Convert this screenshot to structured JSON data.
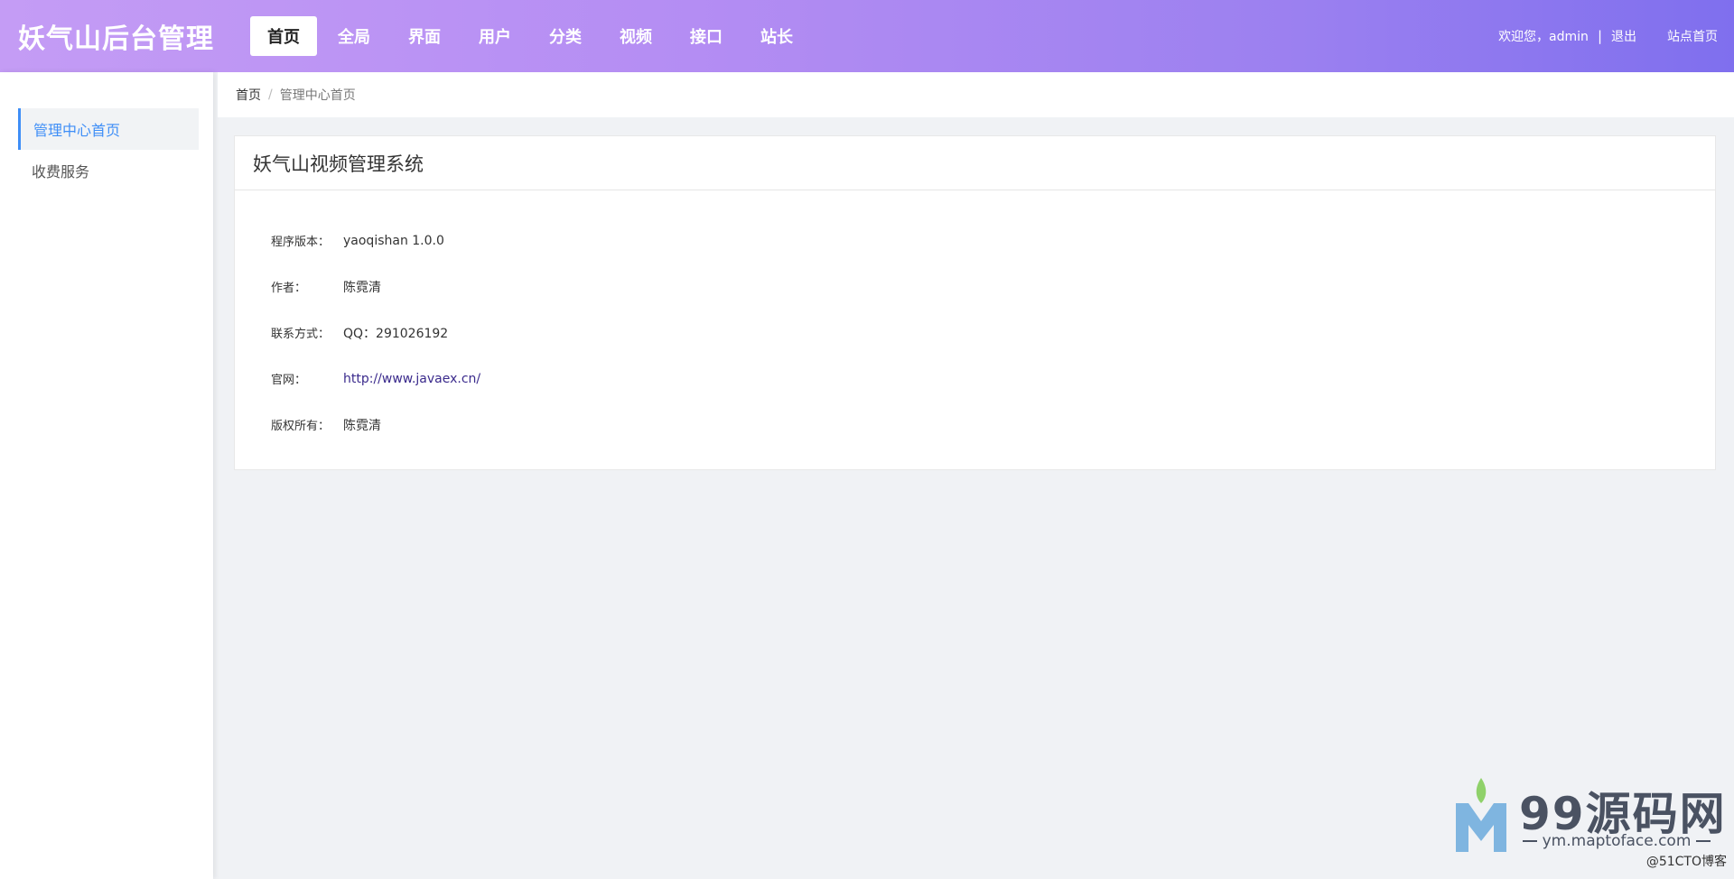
{
  "header": {
    "brand": "妖气山后台管理",
    "nav": [
      {
        "label": "首页",
        "active": true
      },
      {
        "label": "全局",
        "active": false
      },
      {
        "label": "界面",
        "active": false
      },
      {
        "label": "用户",
        "active": false
      },
      {
        "label": "分类",
        "active": false
      },
      {
        "label": "视频",
        "active": false
      },
      {
        "label": "接口",
        "active": false
      },
      {
        "label": "站长",
        "active": false
      }
    ],
    "welcome": "欢迎您，admin",
    "separator": "|",
    "logout": "退出",
    "site_home": "站点首页"
  },
  "sidebar": {
    "items": [
      {
        "label": "管理中心首页",
        "active": true
      },
      {
        "label": "收费服务",
        "active": false
      }
    ]
  },
  "breadcrumb": {
    "home": "首页",
    "divider": "/",
    "current": "管理中心首页"
  },
  "panel": {
    "title": "妖气山视频管理系统",
    "rows": [
      {
        "label": "程序版本：",
        "value": "yaoqishan 1.0.0"
      },
      {
        "label": "作者：",
        "value": "陈霓清"
      },
      {
        "label": "联系方式：",
        "value": "QQ：291026192"
      },
      {
        "label": "官网：",
        "value": "http://www.javaex.cn/"
      },
      {
        "label": "版权所有：",
        "value": "陈霓清"
      }
    ]
  },
  "watermark": {
    "brand": "99源码网",
    "url": "ym.maptoface.com",
    "corner": "@51CTO博客"
  },
  "colors": {
    "accent": "#3e8ef7",
    "header_gradient_start": "#c49cf5",
    "header_gradient_end": "#7f6fee",
    "link": "#3a2a8c"
  }
}
